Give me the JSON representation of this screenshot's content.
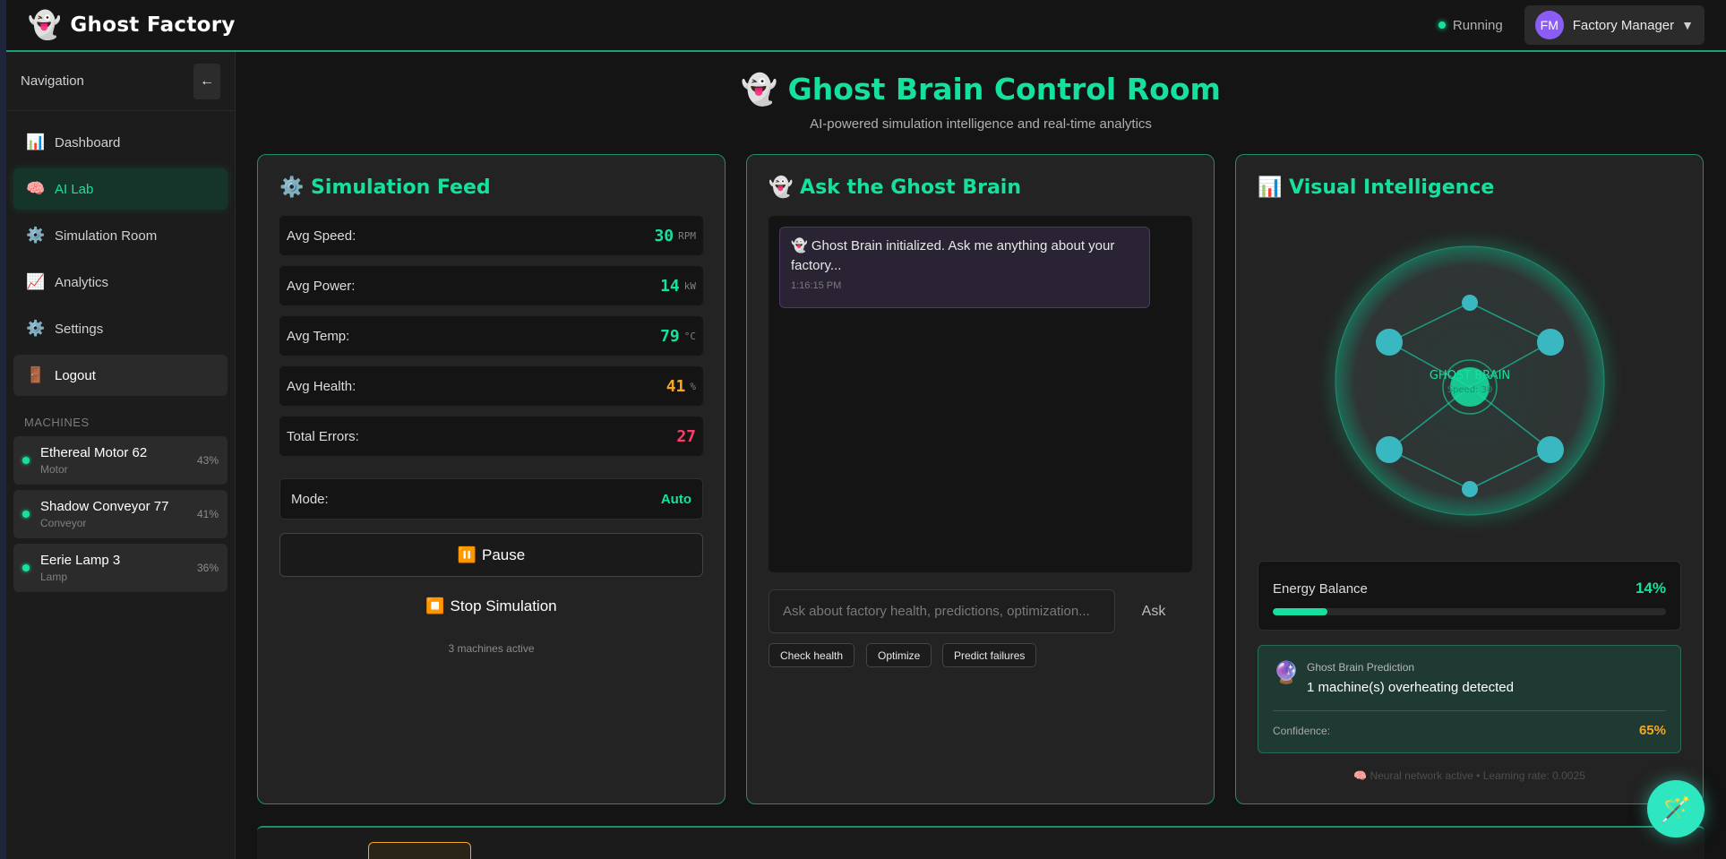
{
  "app": {
    "logo_icon": "ghost-icon",
    "name": "Ghost Factory",
    "status": "Running",
    "user_initials": "FM",
    "user_name": "Factory Manager"
  },
  "sidebar": {
    "title": "Navigation",
    "collapse_glyph": "←",
    "items": [
      {
        "icon": "chart-icon",
        "glyph": "📊",
        "label": "Dashboard",
        "active": false
      },
      {
        "icon": "brain-icon",
        "glyph": "🧠",
        "label": "AI Lab",
        "active": true
      },
      {
        "icon": "gear-icon",
        "glyph": "⚙️",
        "label": "Simulation Room",
        "active": false
      },
      {
        "icon": "trend-icon",
        "glyph": "📈",
        "label": "Analytics",
        "active": false
      },
      {
        "icon": "gear-icon",
        "glyph": "⚙️",
        "label": "Settings",
        "active": false
      },
      {
        "icon": "door-icon",
        "glyph": "🚪",
        "label": "Logout",
        "active": false
      }
    ],
    "machines_label": "MACHINES",
    "machines": [
      {
        "name": "Ethereal Motor 62",
        "type": "Motor",
        "pct": "43%"
      },
      {
        "name": "Shadow Conveyor 77",
        "type": "Conveyor",
        "pct": "41%"
      },
      {
        "name": "Eerie Lamp 3",
        "type": "Lamp",
        "pct": "36%"
      }
    ]
  },
  "page": {
    "title": "👻 Ghost Brain Control Room",
    "subtitle": "AI-powered simulation intelligence and real-time analytics"
  },
  "feed": {
    "title": "⚙️ Simulation Feed",
    "stats": [
      {
        "label": "Avg Speed:",
        "value": "30",
        "unit": "RPM",
        "color": "#16e0a0"
      },
      {
        "label": "Avg Power:",
        "value": "14",
        "unit": "kW",
        "color": "#16e0a0"
      },
      {
        "label": "Avg Temp:",
        "value": "79",
        "unit": "°C",
        "color": "#16e0a0"
      },
      {
        "label": "Avg Health:",
        "value": "41",
        "unit": "%",
        "color": "#f5a623"
      },
      {
        "label": "Total Errors:",
        "value": "27",
        "unit": "",
        "color": "#ff3d6b"
      }
    ],
    "mode_label": "Mode:",
    "mode_value": "Auto",
    "pause_glyph": "⏸️",
    "pause_label": "Pause",
    "stop_glyph": "⏹️",
    "stop_label": "Stop Simulation",
    "active_note": "3 machines active"
  },
  "chat": {
    "title": "👻 Ask the Ghost Brain",
    "message": "👻 Ghost Brain initialized. Ask me anything about your factory...",
    "message_time": "1:16:15 PM",
    "input_placeholder": "Ask about factory health, predictions, optimization...",
    "ask_label": "Ask",
    "chips": [
      "Check health",
      "Optimize",
      "Predict failures"
    ]
  },
  "visual": {
    "title": "📊 Visual Intelligence",
    "brain_label": "GHOST BRAIN",
    "brain_sublabel": "Speed: 30",
    "energy_label": "Energy Balance",
    "energy_value": "14%",
    "energy_fraction": 0.14,
    "prediction_icon": "🔮",
    "prediction_label": "Ghost Brain Prediction",
    "prediction_text": "1 machine(s) overheating detected",
    "confidence_label": "Confidence:",
    "confidence_value": "65%",
    "neural_note": "🧠 Neural network active • Learning rate: 0.0025"
  },
  "fab": {
    "icon": "magic-wand-icon",
    "glyph": "🪄"
  },
  "colors": {
    "accent": "#16e0a0",
    "warning": "#f5a623",
    "danger": "#ff3d6b",
    "avatar": "#8b5cf6"
  }
}
